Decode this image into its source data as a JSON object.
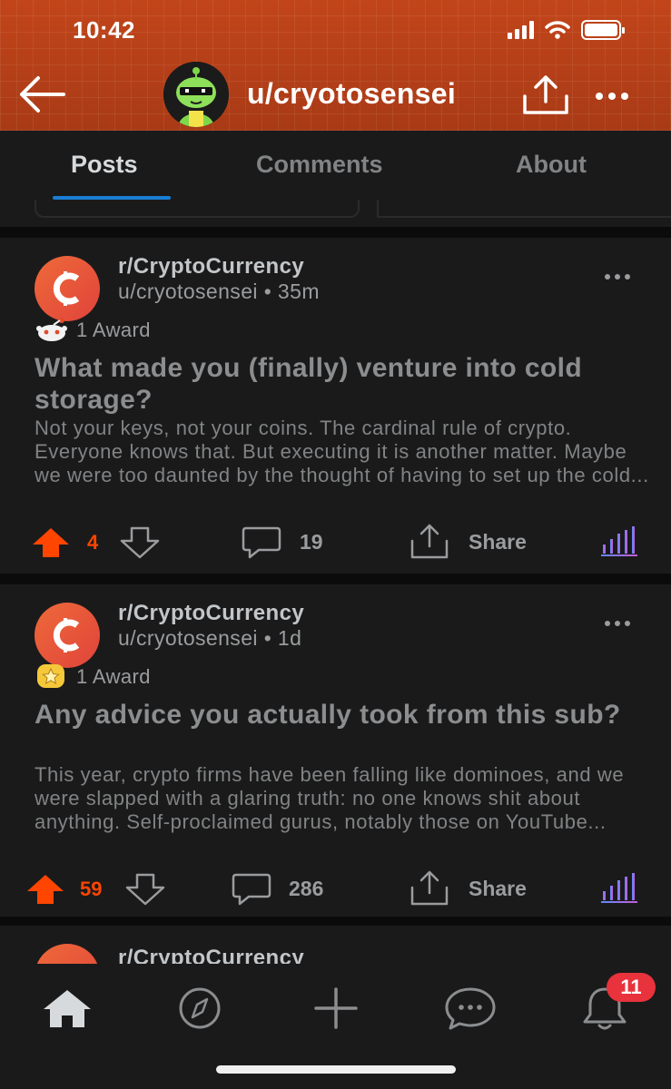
{
  "status_bar": {
    "time": "10:42"
  },
  "header": {
    "username": "u/cryotosensei",
    "icons": {
      "back": "arrow-left-icon",
      "share": "share-icon",
      "more": "more-horizontal-icon"
    }
  },
  "tabs": [
    {
      "label": "Posts",
      "active": true
    },
    {
      "label": "Comments",
      "active": false
    },
    {
      "label": "About",
      "active": false
    }
  ],
  "posts": [
    {
      "subreddit": "r/CryptoCurrency",
      "author_line": "u/cryotosensei • 35m",
      "award_label": "1 Award",
      "award_icon": "snoo-award-icon",
      "title": "What made you (finally) venture into cold storage?",
      "body": "Not your keys, not your coins. The cardinal rule of crypto. Everyone knows that. But executing it is another matter. Maybe we were too daunted by the thought of having to set up the cold...",
      "votes": "4",
      "comments": "19",
      "share_label": "Share"
    },
    {
      "subreddit": "r/CryptoCurrency",
      "author_line": "u/cryotosensei • 1d",
      "award_label": "1 Award",
      "award_icon": "star-award-icon",
      "title": "Any advice you actually took from this sub?",
      "body": "This year, crypto firms have been falling like dominoes, and we were slapped with a glaring truth: no one knows shit about anything. Self-proclaimed gurus, notably those on YouTube...",
      "votes": "59",
      "comments": "286",
      "share_label": "Share"
    },
    {
      "subreddit": "r/CryptoCurrency"
    }
  ],
  "bottom_nav": {
    "items": [
      "home-icon",
      "compass-icon",
      "plus-icon",
      "chat-icon",
      "bell-icon"
    ],
    "notification_count": "11"
  },
  "colors": {
    "header": "#b8441a",
    "upvote": "#ff4500",
    "accent": "#1a7fd4",
    "badge": "#e8323c"
  }
}
